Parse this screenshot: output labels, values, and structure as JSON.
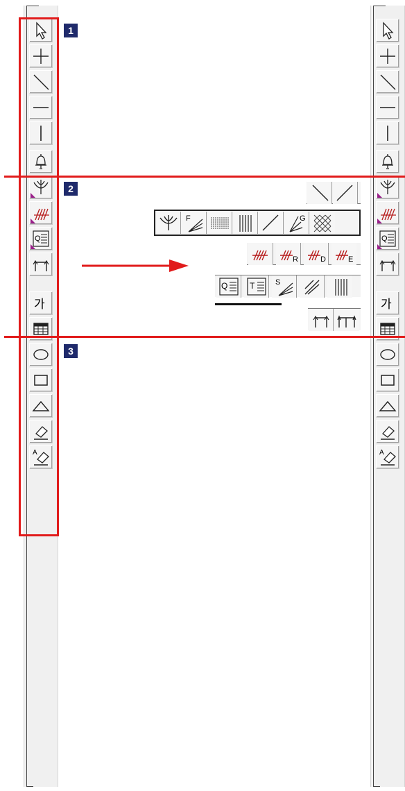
{
  "badges": [
    "1",
    "2",
    "3"
  ],
  "toolbar_tools": [
    {
      "name": "select",
      "icon": "select-arrow-icon",
      "submenu": false
    },
    {
      "name": "cross",
      "icon": "crosshair-icon",
      "submenu": false
    },
    {
      "name": "diagonal-line",
      "icon": "diagonal-line-icon",
      "submenu": false
    },
    {
      "name": "horizontal-line",
      "icon": "horizontal-line-icon",
      "submenu": false
    },
    {
      "name": "vertical-line",
      "icon": "vertical-line-icon",
      "submenu": false
    },
    {
      "name": "alarm",
      "icon": "bell-icon",
      "submenu": false
    },
    {
      "name": "fibonacci",
      "icon": "fan-icon",
      "submenu": true
    },
    {
      "name": "gann",
      "icon": "gann-lines-icon",
      "submenu": true
    },
    {
      "name": "quadrant",
      "icon": "quadrant-icon",
      "submenu": true
    },
    {
      "name": "cycle",
      "icon": "cycle-arrows-icon",
      "submenu": false
    },
    {
      "name": "text",
      "icon": "korean-text-icon",
      "label": "가",
      "submenu": false
    },
    {
      "name": "table",
      "icon": "table-grid-icon",
      "submenu": false
    },
    {
      "name": "ellipse",
      "icon": "ellipse-icon",
      "submenu": false
    },
    {
      "name": "rectangle",
      "icon": "rectangle-icon",
      "submenu": false
    },
    {
      "name": "triangle",
      "icon": "triangle-icon",
      "submenu": false
    },
    {
      "name": "eraser",
      "icon": "eraser-icon",
      "submenu": false
    },
    {
      "name": "eraser-all",
      "icon": "eraser-all-icon",
      "label": "A",
      "submenu": false
    }
  ],
  "palettes": {
    "lines": [
      "line-down-icon",
      "line-up-icon"
    ],
    "fans": [
      {
        "icon": "pitchfork-icon"
      },
      {
        "icon": "fan-f-icon",
        "label": "F"
      },
      {
        "icon": "horizontal-lines-icon"
      },
      {
        "icon": "vertical-lines-icon"
      },
      {
        "icon": "trend-line-icon"
      },
      {
        "icon": "fan-g-icon",
        "label": "G"
      },
      {
        "icon": "crosshatch-icon"
      }
    ],
    "gann": [
      {
        "icon": "gann-icon",
        "label": ""
      },
      {
        "icon": "gann-r-icon",
        "label": "R"
      },
      {
        "icon": "gann-d-icon",
        "label": "D"
      },
      {
        "icon": "gann-e-icon",
        "label": "E"
      }
    ],
    "quadrant": [
      {
        "icon": "quadrant-q-icon"
      },
      {
        "icon": "tirone-icon"
      },
      {
        "icon": "speed-fan-icon",
        "label": "S"
      },
      {
        "icon": "speed-lines-icon"
      },
      {
        "icon": "vertical-ticks-icon"
      }
    ],
    "cycle": [
      "cycle-single-icon",
      "cycle-double-icon"
    ]
  },
  "colors": {
    "annotation": "#e11b1b",
    "badge": "#1f2a6b",
    "submenu_marker": "#9a1f8a"
  }
}
